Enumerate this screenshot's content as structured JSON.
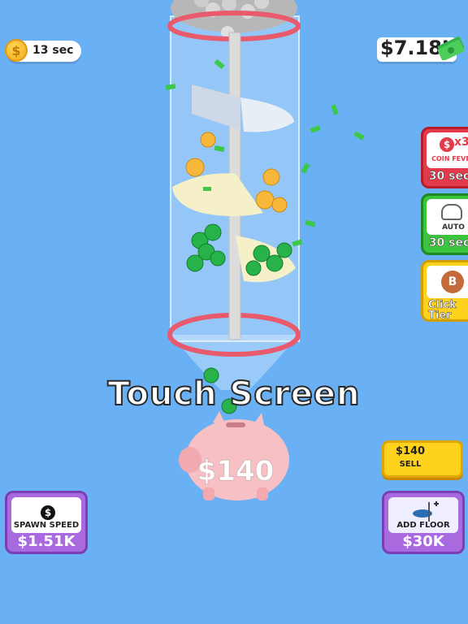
{
  "hud": {
    "timer": "13 sec",
    "money": "$7.18K"
  },
  "boosters": {
    "fever": {
      "label": "COIN FEVER",
      "multiplier": "x3",
      "time": "30 sec"
    },
    "auto": {
      "label": "AUTO",
      "time": "30 sec"
    },
    "tier": {
      "badge": "B",
      "label": "Click Tier"
    }
  },
  "main": {
    "prompt": "Touch Screen",
    "piggy_value": "$140"
  },
  "sell": {
    "price": "$140",
    "label": "SELL"
  },
  "upgrades": {
    "spawn_speed": {
      "label": "SPAWN SPEED",
      "cost": "$1.51K"
    },
    "add_floor": {
      "label": "ADD FLOOR",
      "cost": "$30K"
    }
  }
}
